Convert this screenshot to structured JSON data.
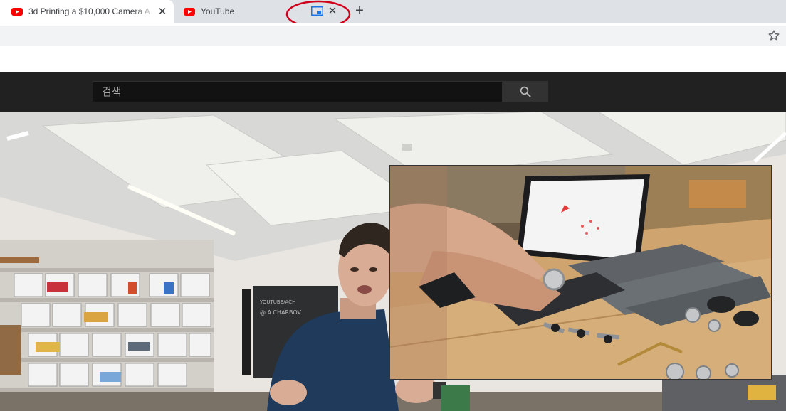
{
  "browser": {
    "tabs": [
      {
        "title": "3d Printing a $10,000 Camera A",
        "active": true,
        "favicon": "youtube-favicon-icon"
      },
      {
        "title": "YouTube",
        "active": false,
        "favicon": "youtube-favicon-icon"
      }
    ],
    "tab_close_glyph": "✕",
    "new_tab_glyph": "+",
    "icons": {
      "pip": "picture-in-picture-icon",
      "star": "bookmark-star-icon",
      "annotation": "red-circle-annotation"
    }
  },
  "youtube": {
    "search_placeholder": "검색",
    "search_icon": "search-icon"
  },
  "colors": {
    "tabstrip": "#dee1e6",
    "youtube_red": "#ff0000",
    "masthead": "#212121",
    "annotation_red": "#d0021b",
    "pip_icon_blue": "#1a73e8"
  }
}
